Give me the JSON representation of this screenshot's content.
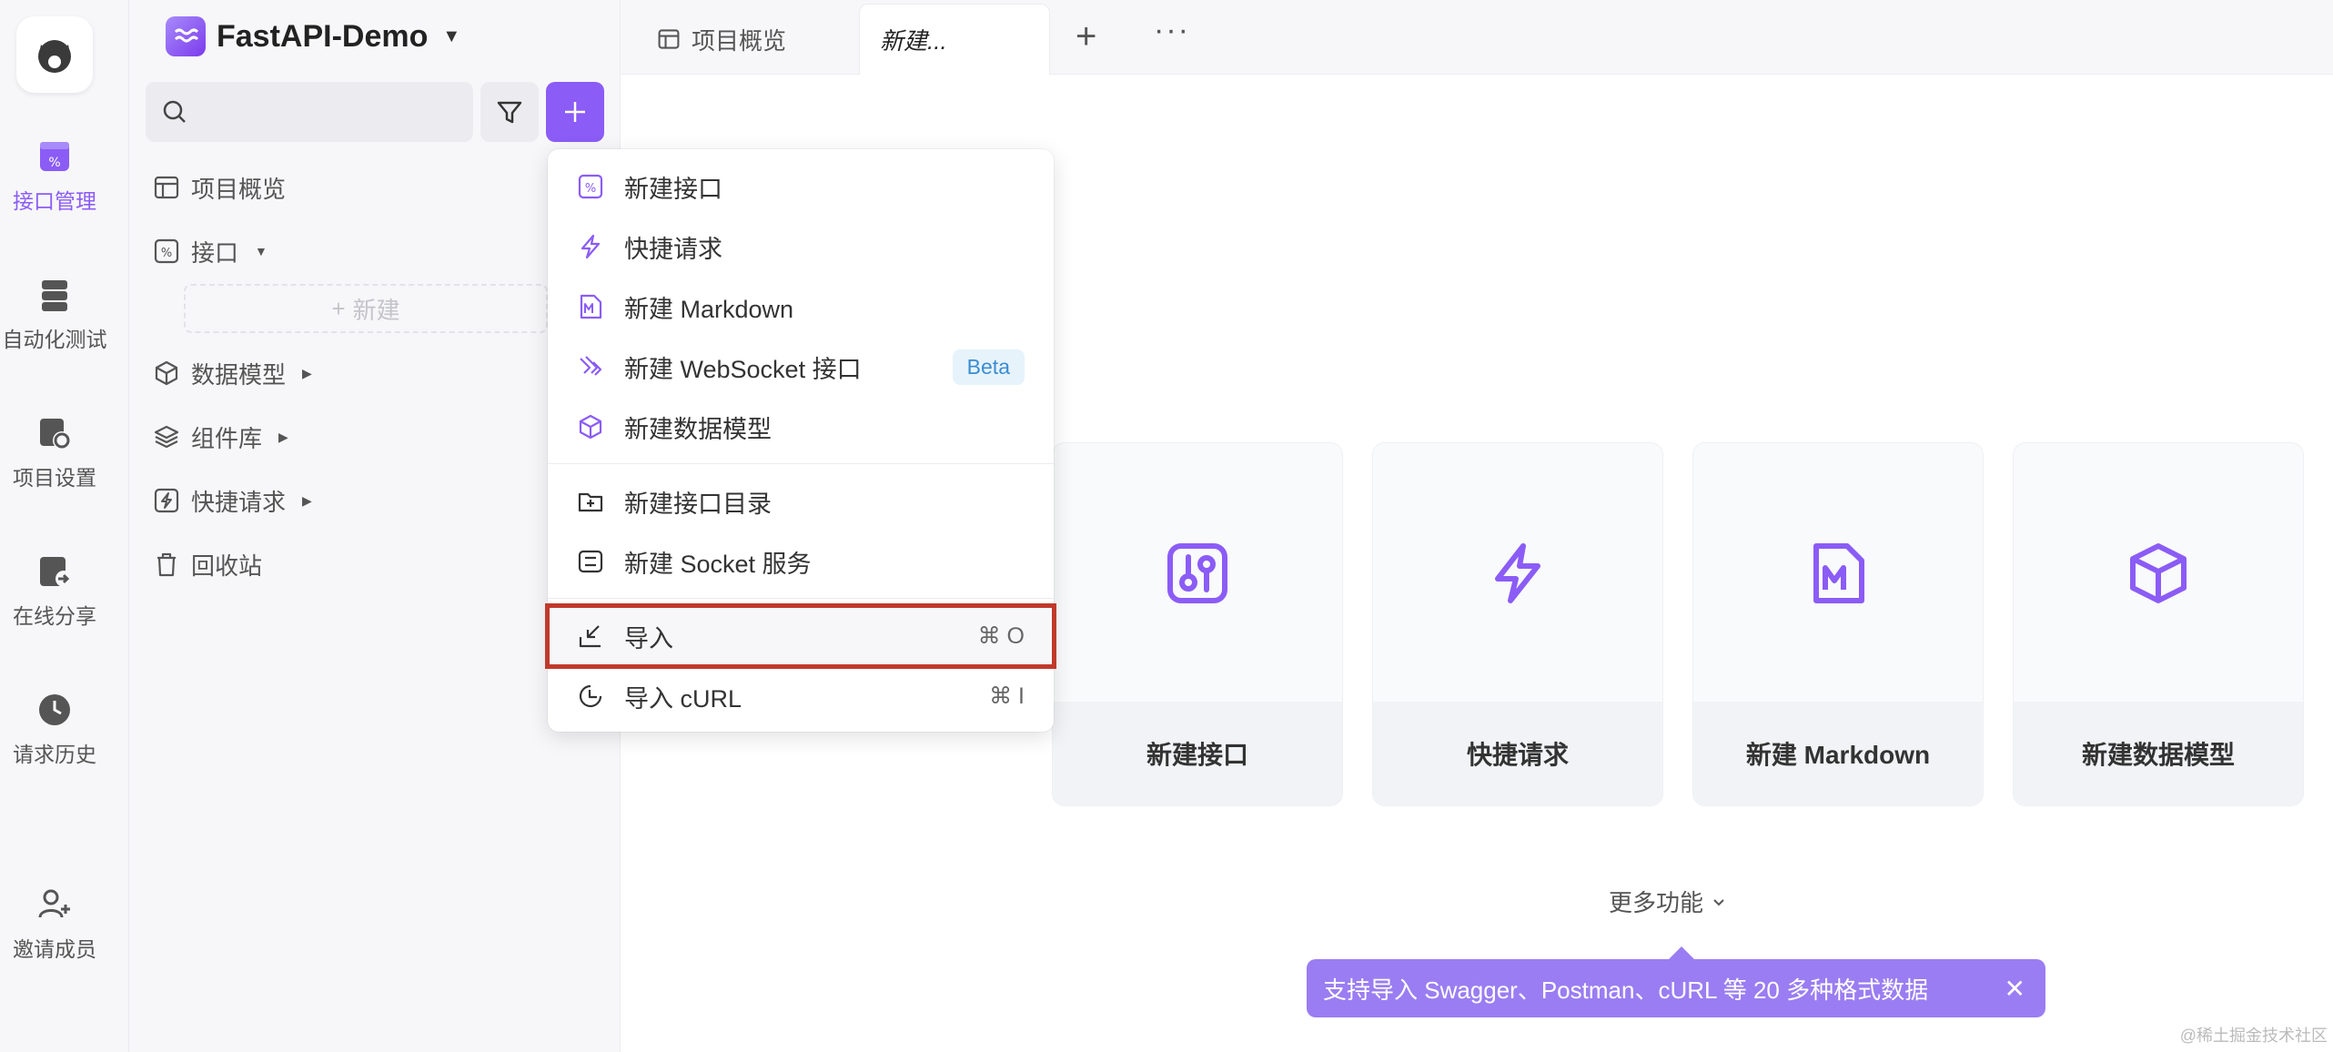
{
  "rail": {
    "items": [
      {
        "label": "接口管理",
        "icon": "api-management-icon",
        "active": true
      },
      {
        "label": "自动化测试",
        "icon": "automation-test-icon"
      },
      {
        "label": "项目设置",
        "icon": "project-settings-icon"
      },
      {
        "label": "在线分享",
        "icon": "online-share-icon"
      },
      {
        "label": "请求历史",
        "icon": "request-history-icon"
      },
      {
        "label": "邀请成员",
        "icon": "invite-member-icon"
      }
    ]
  },
  "sidebar": {
    "project_name": "FastAPI-Demo",
    "search_placeholder": "",
    "items": [
      {
        "label": "项目概览",
        "icon": "overview-icon"
      },
      {
        "label": "接口",
        "icon": "api-icon"
      },
      {
        "label": "数据模型",
        "icon": "cube-icon"
      },
      {
        "label": "组件库",
        "icon": "layers-icon"
      },
      {
        "label": "快捷请求",
        "icon": "quick-request-icon"
      },
      {
        "label": "回收站",
        "icon": "trash-icon"
      }
    ],
    "new_label": "新建"
  },
  "tabs": [
    {
      "label": "项目概览"
    },
    {
      "label": "新建..."
    }
  ],
  "menu": {
    "items": [
      {
        "label": "新建接口",
        "icon": "api-icon"
      },
      {
        "label": "快捷请求",
        "icon": "bolt-icon"
      },
      {
        "label": "新建 Markdown",
        "icon": "markdown-icon"
      },
      {
        "label": "新建 WebSocket 接口",
        "icon": "websocket-icon",
        "badge": "Beta"
      },
      {
        "label": "新建数据模型",
        "icon": "cube-icon"
      },
      {
        "label": "新建接口目录",
        "icon": "folder-plus-icon"
      },
      {
        "label": "新建 Socket 服务",
        "icon": "socket-icon"
      },
      {
        "label": "导入",
        "icon": "import-icon",
        "shortcut": "⌘ O"
      },
      {
        "label": "导入 cURL",
        "icon": "curl-icon",
        "shortcut": "⌘ I"
      }
    ]
  },
  "cards": [
    {
      "label": "新建接口",
      "icon": "api-icon"
    },
    {
      "label": "快捷请求",
      "icon": "bolt-icon"
    },
    {
      "label": "新建 Markdown",
      "icon": "markdown-icon"
    },
    {
      "label": "新建数据模型",
      "icon": "cube-icon"
    }
  ],
  "more_features": "更多功能",
  "tooltip": "支持导入 Swagger、Postman、cURL 等 20 多种格式数据",
  "watermark": "@稀土掘金技术社区",
  "colors": {
    "accent": "#8b5cf6",
    "highlight_border": "#c0392b"
  }
}
